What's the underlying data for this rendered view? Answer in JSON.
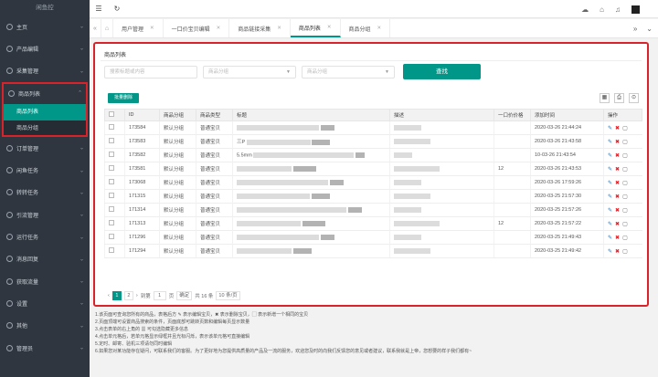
{
  "sidebar": {
    "brand": "闲鱼控",
    "items": [
      {
        "label": "主页",
        "icon": "home-icon"
      },
      {
        "label": "产品编辑",
        "icon": "edit-icon"
      },
      {
        "label": "采集管理",
        "icon": "download-icon"
      },
      {
        "label": "商品列表",
        "icon": "list-icon",
        "expanded": true,
        "children": [
          {
            "label": "商品列表",
            "current": true
          },
          {
            "label": "商品分组",
            "current": false
          }
        ]
      },
      {
        "label": "订单管理",
        "icon": "order-icon"
      },
      {
        "label": "闲鱼任务",
        "icon": "task-icon"
      },
      {
        "label": "转转任务",
        "icon": "task-icon"
      },
      {
        "label": "引流管理",
        "icon": "traffic-icon"
      },
      {
        "label": "运行任务",
        "icon": "run-icon"
      },
      {
        "label": "消息回复",
        "icon": "message-icon"
      },
      {
        "label": "获取流量",
        "icon": "flow-icon"
      },
      {
        "label": "设置",
        "icon": "gear-icon"
      },
      {
        "label": "其他",
        "icon": "more-icon"
      },
      {
        "label": "管理员",
        "icon": "user-icon"
      }
    ]
  },
  "tabs": [
    {
      "label": "用户管理",
      "current": false
    },
    {
      "label": "一口价宝贝编辑",
      "current": false
    },
    {
      "label": "商品链接采集",
      "current": false
    },
    {
      "label": "商品列表",
      "current": true
    },
    {
      "label": "商品分组",
      "current": false
    }
  ],
  "panel": {
    "title": "商品列表",
    "filters": {
      "keyword_placeholder": "搜索标题或内容",
      "group_placeholder": "商品分组",
      "type_placeholder": "商品分组"
    },
    "search_label": "查找",
    "batch_delete_label": "批量删除"
  },
  "table": {
    "columns": [
      "ID",
      "商品分组",
      "商品类型",
      "标题",
      "描述",
      "一口价价格",
      "添加时间",
      "操作"
    ],
    "rows": [
      {
        "id": "173584",
        "group": "默认分组",
        "type": "普通宝贝",
        "title": "",
        "price": "",
        "time": "2020-03-26 21:44:24"
      },
      {
        "id": "173583",
        "group": "默认分组",
        "type": "普通宝贝",
        "title": "三P",
        "price": "",
        "time": "2020-03-26 21:43:58"
      },
      {
        "id": "173582",
        "group": "默认分组",
        "type": "普通宝贝",
        "title": "5.5mm",
        "price": "",
        "time": "10-03-26 21:43:54"
      },
      {
        "id": "173581",
        "group": "默认分组",
        "type": "普通宝贝",
        "title": "",
        "price": "12",
        "time": "2020-03-26 21:43:53"
      },
      {
        "id": "173068",
        "group": "默认分组",
        "type": "普通宝贝",
        "title": "",
        "price": "",
        "time": "2020-03-26 17:59:26"
      },
      {
        "id": "171315",
        "group": "默认分组",
        "type": "普通宝贝",
        "title": "",
        "price": "",
        "time": "2020-03-25 21:57:30"
      },
      {
        "id": "171314",
        "group": "默认分组",
        "type": "普通宝贝",
        "title": "",
        "price": "",
        "time": "2020-03-25 21:57:26"
      },
      {
        "id": "171313",
        "group": "默认分组",
        "type": "普通宝贝",
        "title": "",
        "price": "12",
        "time": "2020-03-25 21:57:22"
      },
      {
        "id": "171296",
        "group": "默认分组",
        "type": "普通宝贝",
        "title": "",
        "price": "",
        "time": "2020-03-25 21:49:43"
      },
      {
        "id": "171294",
        "group": "默认分组",
        "type": "普通宝贝",
        "title": "",
        "price": "",
        "time": "2020-03-25 21:49:42"
      }
    ]
  },
  "pagination": {
    "pages": [
      "1",
      "2"
    ],
    "goto_label": "到第",
    "goto_value": "1",
    "page_unit": "页",
    "confirm_label": "确定",
    "total_label": "共 16 条",
    "page_size_label": "10 条/页"
  },
  "notes": [
    "1.该页面可查询您所有的商品，表格后方 ✎ 表示编辑宝贝，✖ 表示删除宝贝，▢ 表示新增一个相同的宝贝",
    "2.页面顶端可设置商品搜索的条件，页面底部可跳转页数和编辑每页显示数量",
    "3.点击表单的右上角的 ▦ 可勾选隐藏更多信息",
    "4.点击单元格后，若单元格显示绿框并且光标闪烁，表示该单元格可直接编辑",
    "5.定时、邮寄、验机三项请勿同时编辑",
    "6.如果您对某功能存在疑问，可联系我们的客服。为了更好地为您提供高质量的产品及一流的服务，欢迎您及时的向我们反馈您的意见或者建议，联系我就是上帝，您想要的样子我们都有~"
  ],
  "colors": {
    "accent": "#009688",
    "highlight": "#d9232a",
    "sidebar": "#2f3640"
  }
}
